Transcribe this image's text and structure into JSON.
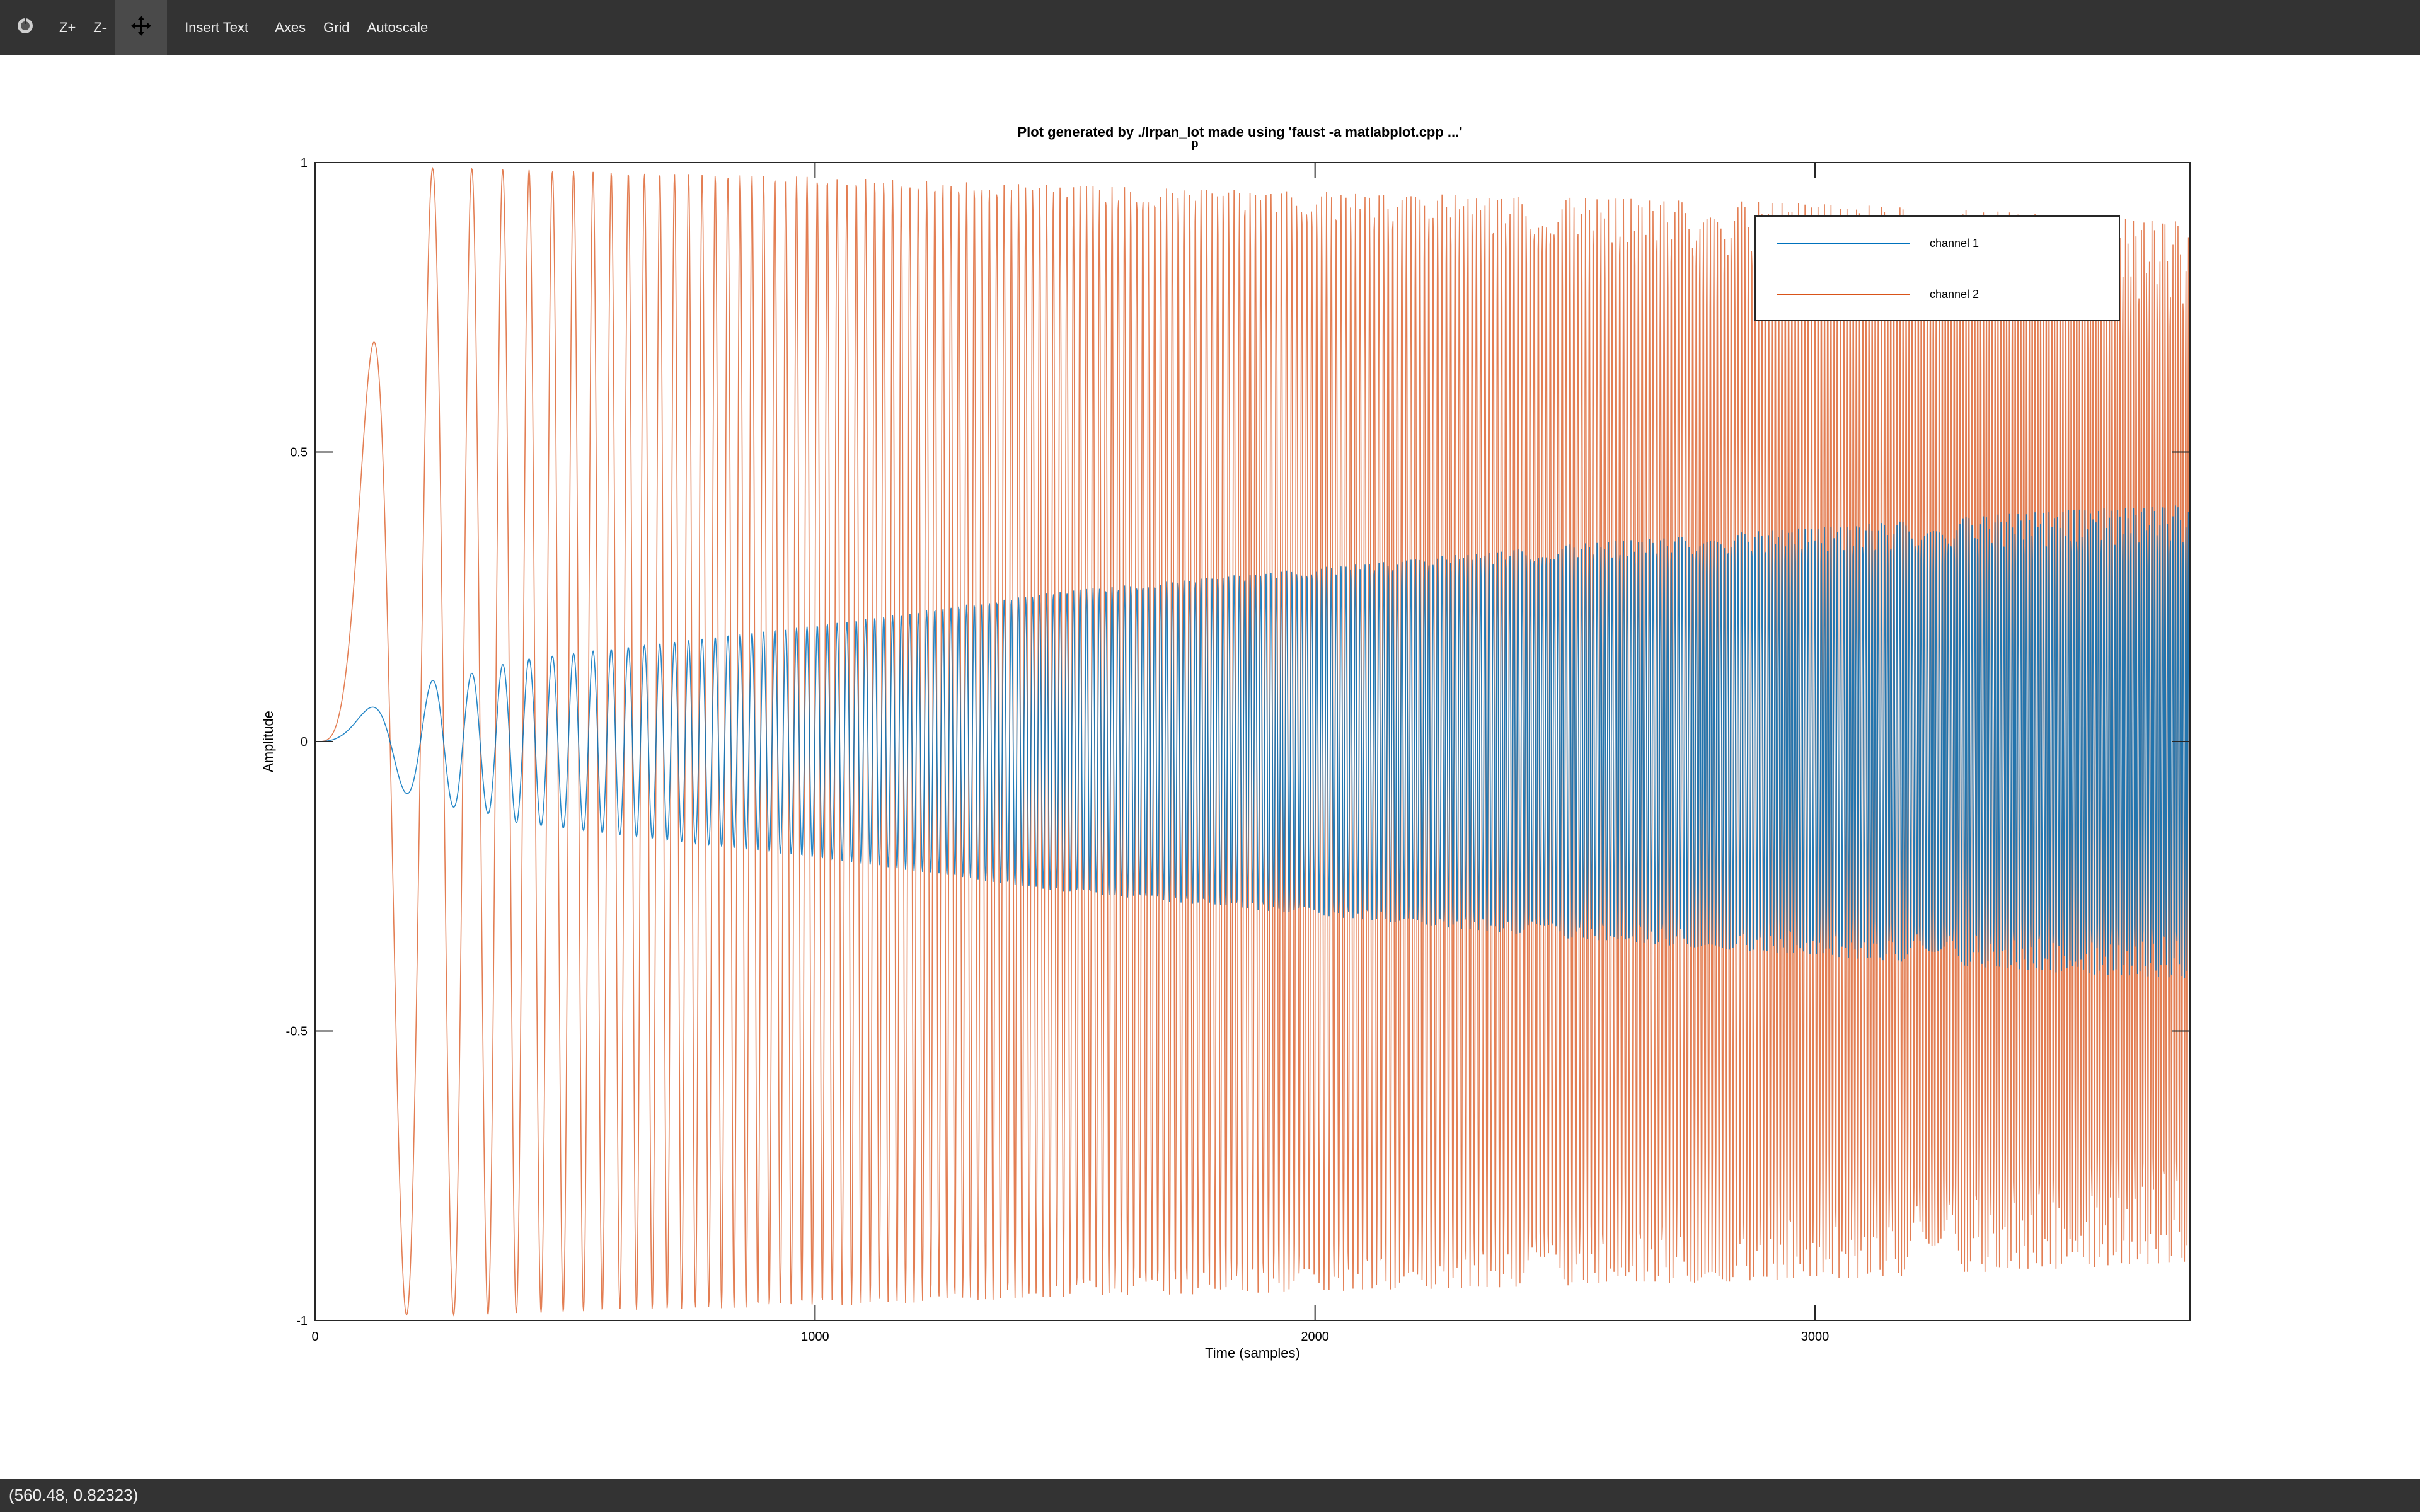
{
  "toolbar": {
    "buttons": [
      {
        "label": "",
        "icon": "reset-icon"
      },
      {
        "label": "Z+"
      },
      {
        "label": "Z-"
      },
      {
        "label": "",
        "icon": "pan-icon"
      },
      {
        "label": "Insert Text"
      },
      {
        "label": "Axes"
      },
      {
        "label": "Grid"
      },
      {
        "label": "Autoscale"
      }
    ]
  },
  "status": {
    "coords": "(560.48, 0.82323)"
  },
  "colors": {
    "channel1": "#0072BD",
    "channel2": "#D95319",
    "toolbar": "#333333"
  },
  "chart_data": {
    "type": "line",
    "title_line1": "Plot generated by ./lrpan_lot made using 'faust -a matlabplot.cpp ...'",
    "title_line2": "p",
    "xlabel": "Time (samples)",
    "ylabel": "Amplitude",
    "xlim": [
      0,
      3750
    ],
    "ylim": [
      -1,
      1
    ],
    "xticks": [
      0,
      1000,
      2000,
      3000
    ],
    "xtick_labels": [
      "0",
      "1000",
      "2000",
      "3000"
    ],
    "yticks": [
      1,
      0.5,
      0,
      -0.5,
      -1
    ],
    "ytick_labels": [
      "1",
      "0.5",
      "0",
      "-0.5",
      "-1"
    ],
    "grid": false,
    "legend_position": "top-right",
    "series": [
      {
        "name": "channel 1",
        "description_envelope": "chirp oscillation, amplitude grows from 0 to about 0.4",
        "envelope_x": [
          0,
          150,
          250,
          330,
          400,
          500,
          700,
          1000,
          1500,
          2000,
          2500,
          3000,
          3500,
          3750
        ],
        "envelope_y": [
          0,
          0.08,
          0.11,
          0.12,
          0.14,
          0.15,
          0.17,
          0.2,
          0.26,
          0.3,
          0.34,
          0.37,
          0.4,
          0.41
        ]
      },
      {
        "name": "channel 2",
        "description_envelope": "chirp oscillation, amplitude near 1 decaying slightly to about 0.9",
        "envelope_x": [
          0,
          150,
          250,
          330,
          500,
          1000,
          1500,
          2000,
          2500,
          3000,
          3500,
          3750
        ],
        "envelope_y": [
          0,
          0.99,
          0.99,
          0.99,
          0.985,
          0.975,
          0.96,
          0.95,
          0.94,
          0.93,
          0.91,
          0.9
        ]
      }
    ],
    "first_peak_samples": [
      150,
      250,
      330
    ]
  }
}
